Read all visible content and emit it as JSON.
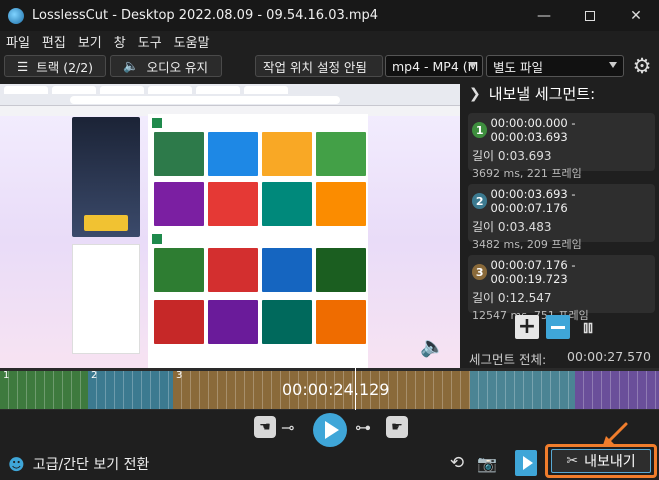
{
  "window": {
    "title": "LosslessCut - Desktop 2022.08.09 - 09.54.16.03.mp4",
    "minimize_icon": "minimize-icon",
    "maximize_icon": "maximize-icon",
    "close_icon": "close-icon"
  },
  "menu": {
    "items": [
      "파일",
      "편집",
      "보기",
      "창",
      "도구",
      "도움말"
    ]
  },
  "toolbar": {
    "tracks_label": "트랙 (2/2)",
    "audio_label": "오디오 유지",
    "working_dir_label": "작업 위치 설정 안됨",
    "format_value": "mp4 - MP4 (M",
    "output_mode_value": "별도 파일",
    "settings_icon": "gear-icon"
  },
  "panel": {
    "header": "내보낼 세그먼트:",
    "segments": [
      {
        "num": "1",
        "range": "00:00:00.000 - 00:00:03.693",
        "length": "길이 0:03.693",
        "detail": "3692 ms, 221 프레임",
        "color": "#3e8e3e"
      },
      {
        "num": "2",
        "range": "00:00:03.693 - 00:00:07.176",
        "length": "길이 0:03.483",
        "detail": "3482 ms, 209 프레임",
        "color": "#3c7a90"
      },
      {
        "num": "3",
        "range": "00:00:07.176 - 00:00:19.723",
        "length": "길이 0:12.547",
        "detail": "12547 ms, 751 프레임",
        "color": "#8a6a3a"
      }
    ],
    "total_label": "세그먼트 전체:",
    "total_value": "00:00:27.570"
  },
  "timeline": {
    "timecode": "00:00:24.129",
    "track_labels": [
      "1",
      "2",
      "3"
    ]
  },
  "controls": {
    "toggle_view_label": "고급/간단 보기 전환",
    "export_label": "내보내기"
  },
  "colors": {
    "accent": "#3fa6d8",
    "export_highlight": "#f07d2c",
    "seg1": "#3e8e3e",
    "seg2": "#3c7a90",
    "seg3": "#8a6a3a",
    "seg4": "#4b8494",
    "seg5": "#6a4f9a"
  }
}
